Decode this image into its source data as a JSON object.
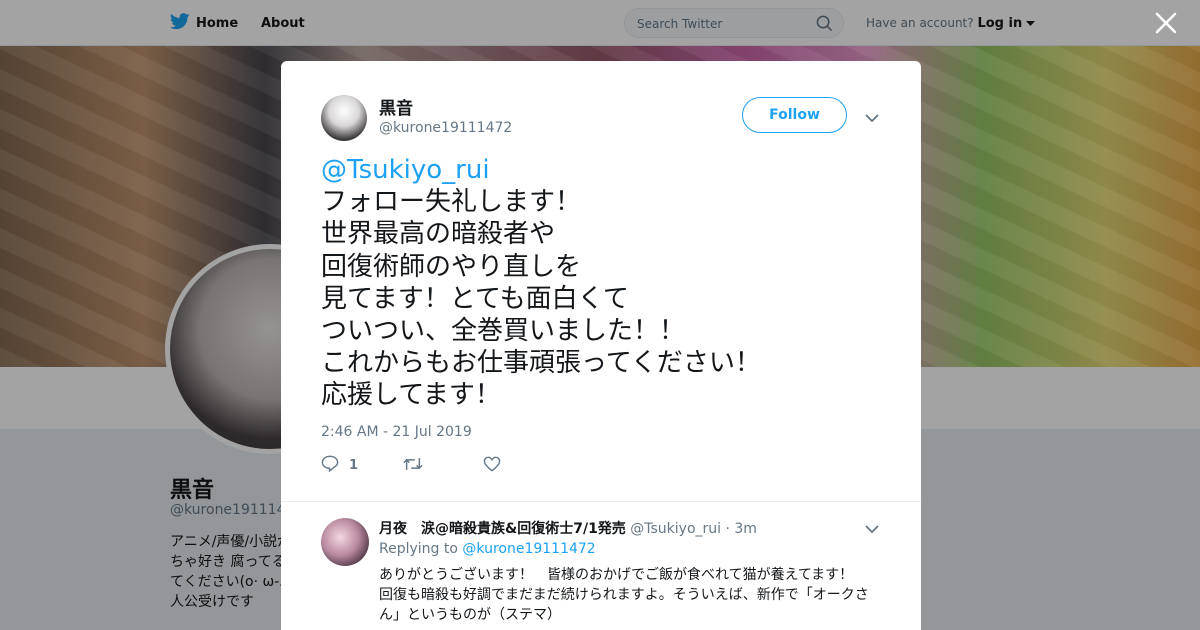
{
  "colors": {
    "accent": "#1da1f2",
    "muted": "#657786",
    "text": "#14171a"
  },
  "topbar": {
    "home_label": "Home",
    "about_label": "About",
    "search_placeholder": "Search Twitter",
    "account_prompt": "Have an account?",
    "login_label": "Log in"
  },
  "profile": {
    "name": "黒音",
    "handle": "@kurone1911147",
    "bio": "アニメ/声優/小説が\nちゃ好き 腐ってる\nてください(o· ω-ﾉ\n人公受けです"
  },
  "tweet": {
    "author_name": "黒音",
    "author_handle": "@kurone19111472",
    "follow_label": "Follow",
    "mention": "@Tsukiyo_rui",
    "body": "フォロー失礼します！\n世界最高の暗殺者や\n回復術師のやり直しを\n見てます！とても面白くて\nついつい、全巻買いました！！\nこれからもお仕事頑張ってください！\n応援してます！",
    "timestamp": "2:46 AM - 21 Jul 2019",
    "reply_count": "1"
  },
  "reply": {
    "name": "月夜　涙@暗殺貴族&回復術士7/1発売",
    "handle": "@Tsukiyo_rui",
    "time": "· 3m",
    "replying_to_label": "Replying to",
    "replying_to_handle": "@kurone19111472",
    "body": "ありがとうございます！　皆様のおかげでご飯が食べれて猫が養えてます！\n回復も暗殺も好調でまだまだ続けられますよ。そういえば、新作で「オークさ\nん」というものが（ステマ）"
  }
}
